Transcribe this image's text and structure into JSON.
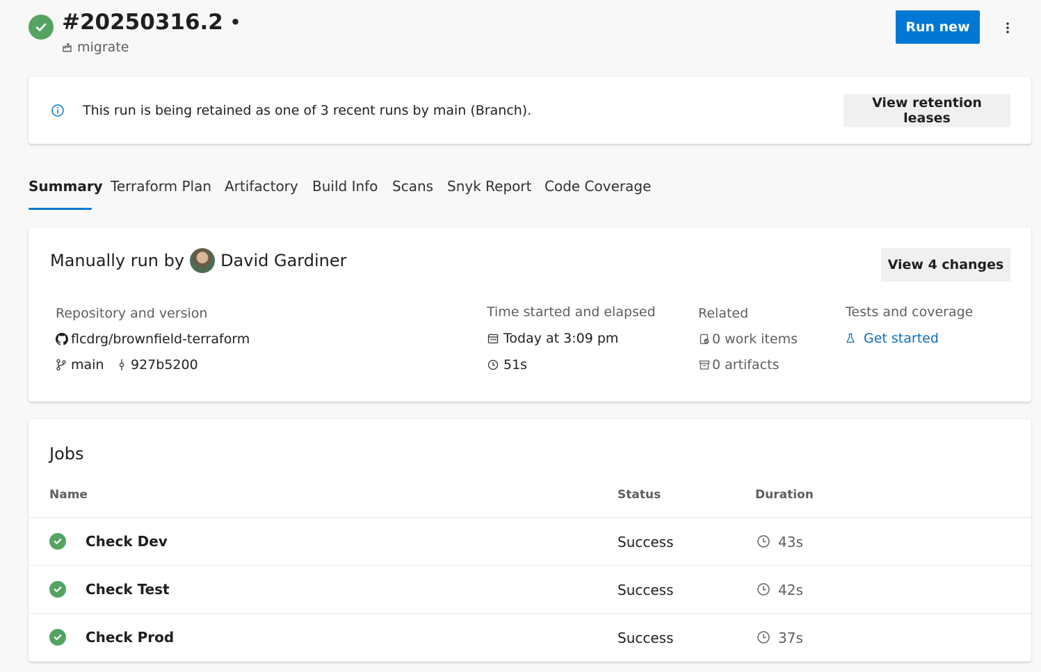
{
  "header": {
    "run_id": "#20250316.2",
    "run_id_suffix": "•",
    "pipeline_name": "migrate",
    "run_new_label": "Run new",
    "status_icon": "success-check-icon",
    "more_icon": "more-vertical-icon"
  },
  "banner": {
    "message": "This run is being retained as one of 3 recent runs by main (Branch).",
    "button_label": "View retention leases",
    "icon": "info-icon"
  },
  "tabs": [
    {
      "label": "Summary",
      "selected": true
    },
    {
      "label": "Terraform Plan"
    },
    {
      "label": "Artifactory"
    },
    {
      "label": "Build Info"
    },
    {
      "label": "Scans"
    },
    {
      "label": "Snyk Report"
    },
    {
      "label": "Code Coverage"
    }
  ],
  "summary": {
    "run_by_prefix": "Manually run by",
    "user_name": "David Gardiner",
    "view_changes_label": "View 4 changes",
    "repo_label": "Repository and version",
    "repo_name": "flcdrg/brownfield-terraform",
    "branch": "main",
    "commit": "927b5200",
    "time_label": "Time started and elapsed",
    "started": "Today at 3:09 pm",
    "elapsed": "51s",
    "related_label": "Related",
    "work_items": "0 work items",
    "artifacts": "0 artifacts",
    "tests_label": "Tests and coverage",
    "tests_link": "Get started"
  },
  "jobs": {
    "title": "Jobs",
    "columns": {
      "name": "Name",
      "status": "Status",
      "duration": "Duration"
    },
    "rows": [
      {
        "name": "Check Dev",
        "status": "Success",
        "duration": "43s"
      },
      {
        "name": "Check Test",
        "status": "Success",
        "duration": "42s"
      },
      {
        "name": "Check Prod",
        "status": "Success",
        "duration": "37s"
      }
    ]
  },
  "colors": {
    "accent": "#0078d4",
    "success": "#55a362",
    "link": "#0f6cbd"
  }
}
